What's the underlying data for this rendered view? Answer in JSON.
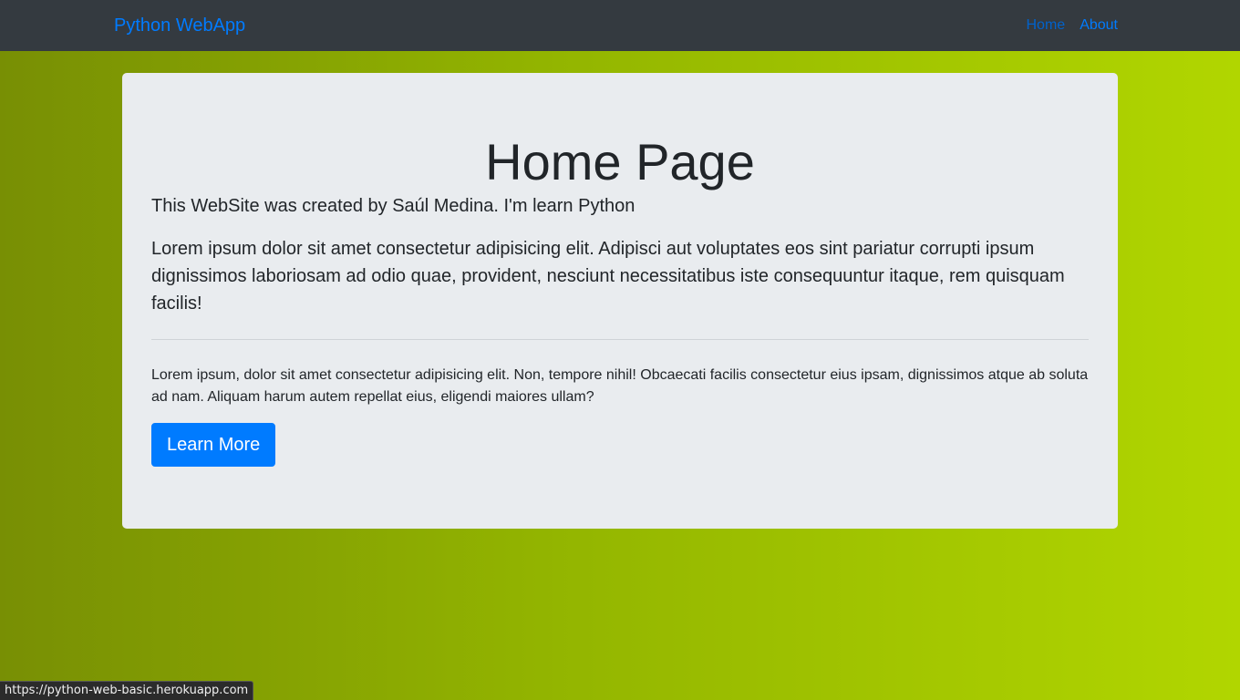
{
  "navbar": {
    "brand": "Python WebApp",
    "links": [
      {
        "label": "Home",
        "active": true
      },
      {
        "label": "About",
        "active": false
      }
    ]
  },
  "jumbotron": {
    "title": "Home Page",
    "subtitle": "This WebSite was created by Saúl Medina. I'm learn Python",
    "lead": "Lorem ipsum dolor sit amet consectetur adipisicing elit. Adipisci aut voluptates eos sint pariatur corrupti ipsum dignissimos laboriosam ad odio quae, provident, nesciunt necessitatibus iste consequuntur itaque, rem quisquam facilis!",
    "body": "Lorem ipsum, dolor sit amet consectetur adipisicing elit. Non, tempore nihil! Obcaecati facilis consectetur eius ipsam, dignissimos atque ab soluta ad nam. Aliquam harum autem repellat eius, eligendi maiores ullam?",
    "button_label": "Learn More"
  },
  "status_bar": {
    "url": "https://python-web-basic.herokuapp.com"
  },
  "colors": {
    "navbar_bg": "#343a40",
    "link": "#007bff",
    "link_active": "#0062cc",
    "jumbotron_bg": "#e9ecef",
    "button_bg": "#007bff",
    "gradient_start": "#788f04",
    "gradient_end": "#b1d600"
  }
}
